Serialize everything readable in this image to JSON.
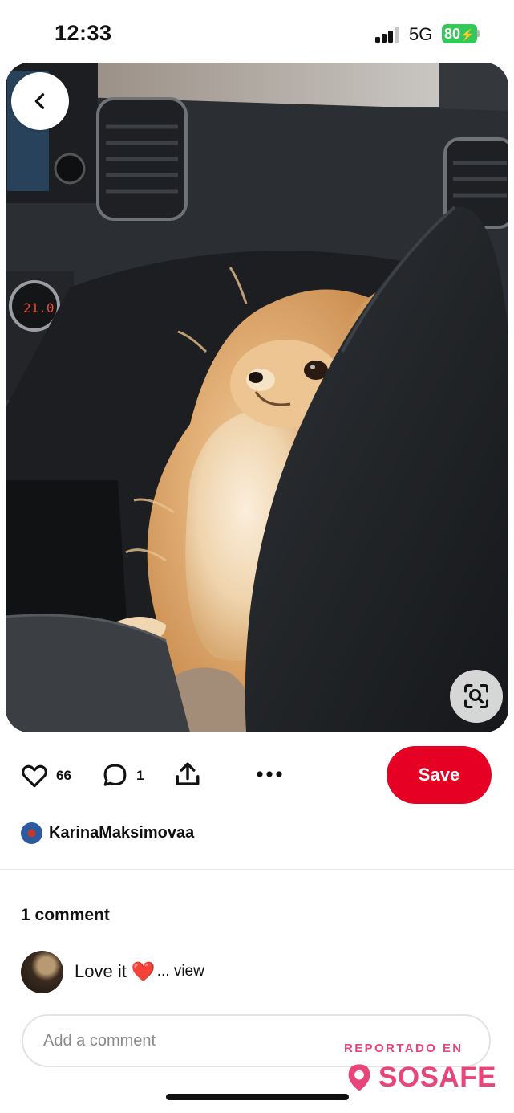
{
  "status_bar": {
    "time": "12:33",
    "network": "5G",
    "battery": "80"
  },
  "pin": {
    "image_icon": "pomeranian-dog-photo",
    "back_icon": "chevron-left-icon",
    "visual_search_icon": "visual-search-icon"
  },
  "actions": {
    "likes": "66",
    "comments": "1",
    "save_label": "Save",
    "like_icon": "heart-outline-icon",
    "comment_icon": "comment-bubble-icon",
    "share_icon": "share-icon",
    "more_icon": "more-dots-icon"
  },
  "author": {
    "name": "KarinaMaksimovaa"
  },
  "comments": {
    "heading": "1 comment",
    "items": [
      {
        "text": "Love it",
        "emoji": "❤️",
        "view_label": "... view"
      }
    ],
    "input_placeholder": "Add a comment"
  },
  "watermark": {
    "label": "REPORTADO EN",
    "brand": "SOSAFE"
  },
  "colors": {
    "save": "#e60023",
    "battery": "#34c759",
    "watermark": "#e8467a"
  }
}
